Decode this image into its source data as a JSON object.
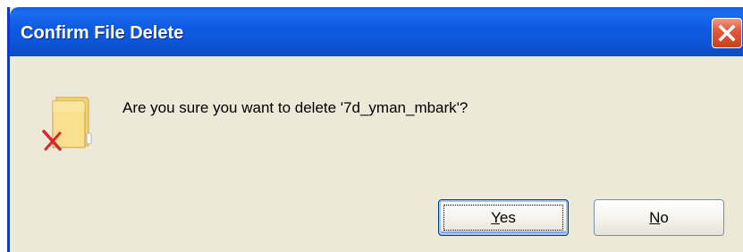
{
  "window": {
    "title": "Confirm File Delete"
  },
  "dialog": {
    "message": "Are you sure you want to delete '7d_yman_mbark'?",
    "icon": "folder-delete-icon"
  },
  "buttons": {
    "yes": {
      "mnemonic": "Y",
      "rest": "es"
    },
    "no": {
      "mnemonic": "N",
      "rest": "o"
    }
  },
  "colors": {
    "titlebar": "#0a5fe6",
    "dialog_bg": "#ece9d8",
    "close_button": "#e05a3c"
  }
}
